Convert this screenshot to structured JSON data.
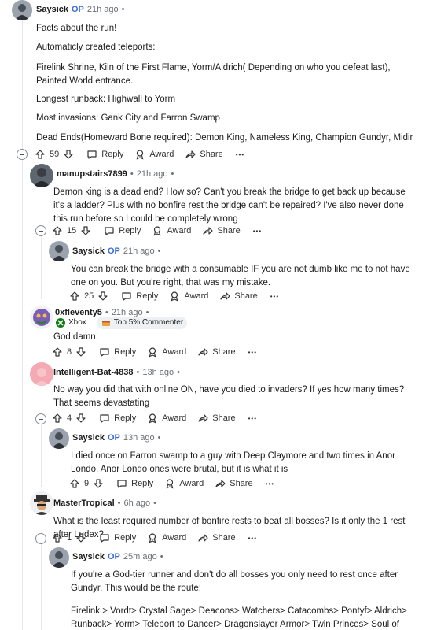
{
  "c1": {
    "user": "Saysick",
    "op": "OP",
    "time": "21h ago",
    "dot": "•",
    "lines": [
      "Facts about the run!",
      "Automaticly created teleports:",
      "Firelink Shrine, Kiln of the First Flame, Yorm/Aldrich( Depending on who you defeat last), Painted World entrance.",
      "Longest runback: Highwall to Yorm",
      "Most invasions: Gank City and Farron Swamp",
      "Dead Ends(Homeward Bone required): Demon King, Nameless King, Champion Gundyr, Midir"
    ],
    "votes": "59"
  },
  "c2": {
    "user": "manupstairs7899",
    "time": "21h ago",
    "dot": "•",
    "text": "Demon king is a dead end? How so? Can't you break the bridge to get back up because it's a ladder? Plus with no bonfire rest the bridge can't be repaired? I've also never done this run before so I could be completely wrong",
    "votes": "15"
  },
  "c3": {
    "user": "Saysick",
    "op": "OP",
    "time": "21h ago",
    "dot": "•",
    "text": "You can break the bridge with a consumable IF you are not dumb like me to not have one on you. But you're right, that was my mistake.",
    "votes": "25"
  },
  "c4": {
    "user": "0xfleventy5",
    "time": "21h ago",
    "dot": "•",
    "flair1": "Xbox",
    "flair2": "Top 5% Commenter",
    "text": "God damn.",
    "votes": "8"
  },
  "c5": {
    "user": "Intelligent-Bat-4838",
    "time": "13h ago",
    "dot": "•",
    "text": "No way you did that with online ON, have you died to invaders? If yes how many times? That seems devastating",
    "votes": "4"
  },
  "c6": {
    "user": "Saysick",
    "op": "OP",
    "time": "13h ago",
    "dot": "•",
    "text": "I died once on Farron swamp to a guy with Deep Claymore and two times in Anor Londo. Anor Londo ones were brutal, but it is what it is",
    "votes": "9"
  },
  "c7": {
    "user": "MasterTropical",
    "time": "6h ago",
    "dot": "•",
    "text": "What is the least required number of bonfire rests to beat all bosses? Is it only the 1 rest after Ludex?",
    "votes": "1"
  },
  "c8": {
    "user": "Saysick",
    "op": "OP",
    "time": "25m ago",
    "dot": "•",
    "text1": "If you're a God-tier runner and don't do all bosses you only need to rest once after Gundyr. This would be the route:",
    "text2": "Firelink > Vordt> Crystal Sage> Deacons> Watchers> Catacombs> Pontyf> Aldrich> Runback> Yorm> Teleport to Dancer> Dragonslayer Armor> Twin Princes> Soul of Cinder"
  },
  "actions": {
    "reply": "Reply",
    "award": "Award",
    "share": "Share",
    "more": "•••"
  },
  "colors": {
    "op": "#3b6bd6",
    "meta": "#6b7075",
    "rail": "#e5e7e9"
  }
}
